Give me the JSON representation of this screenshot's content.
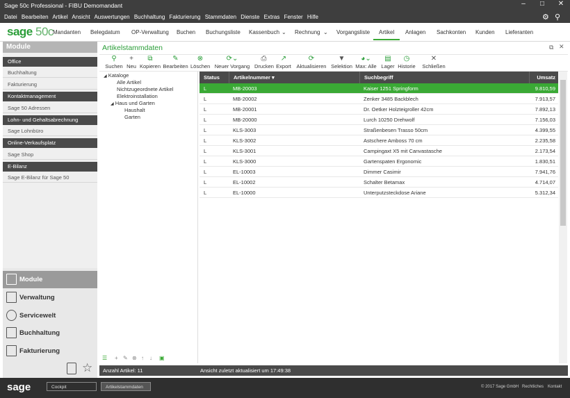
{
  "window": {
    "title": "Sage 50c Professional - FIBU Demomandant"
  },
  "menu": [
    "Datei",
    "Bearbeiten",
    "Artikel",
    "Ansicht",
    "Auswertungen",
    "Buchhaltung",
    "Fakturierung",
    "Stammdaten",
    "Dienste",
    "Extras",
    "Fenster",
    "Hilfe"
  ],
  "logo": {
    "brand": "sage",
    "product": "50c"
  },
  "nav": [
    {
      "label": "Mandanten"
    },
    {
      "label": "Belegdatum"
    },
    {
      "label": "OP-Verwaltung"
    },
    {
      "label": "Buchen"
    },
    {
      "label": "Buchungsliste"
    },
    {
      "label": "Kassenbuch"
    },
    {
      "label": "Rechnung"
    },
    {
      "label": "Vorgangsliste"
    },
    {
      "label": "Artikel"
    },
    {
      "label": "Anlagen"
    },
    {
      "label": "Sachkonten"
    },
    {
      "label": "Kunden"
    },
    {
      "label": "Lieferanten"
    }
  ],
  "sidebar": {
    "title": "Module",
    "rows": [
      {
        "label": "Office",
        "dark": true
      },
      {
        "label": "Buchhaltung",
        "dark": false
      },
      {
        "label": "Fakturierung",
        "dark": false
      },
      {
        "label": "Kontaktmanagement",
        "dark": true
      },
      {
        "label": "Sage 50 Adressen",
        "dark": false
      },
      {
        "label": "Lohn- und Gehaltsabrechnung",
        "dark": true
      },
      {
        "label": "Sage Lohnbüro",
        "dark": false
      },
      {
        "label": "Online-Verkaufsplatz",
        "dark": true
      },
      {
        "label": "Sage Shop",
        "dark": false
      },
      {
        "label": "E-Bilanz",
        "dark": true
      },
      {
        "label": "Sage E-Bilanz für Sage 50",
        "dark": false
      }
    ],
    "modules": [
      {
        "label": "Module",
        "selected": true
      },
      {
        "label": "Verwaltung",
        "selected": false
      },
      {
        "label": "Servicewelt",
        "selected": false
      },
      {
        "label": "Buchhaltung",
        "selected": false
      },
      {
        "label": "Fakturierung",
        "selected": false
      }
    ]
  },
  "main": {
    "title": "Artikelstammdaten",
    "toolbar": [
      {
        "label": "Suchen",
        "icon": "search-icon"
      },
      {
        "label": "Neu",
        "icon": "plus-icon"
      },
      {
        "label": "Kopieren",
        "icon": "copy-icon"
      },
      {
        "label": "Bearbeiten",
        "icon": "edit-icon"
      },
      {
        "label": "Löschen",
        "icon": "delete-icon"
      },
      {
        "label": "Neuer Vorgang",
        "icon": "new-process-icon"
      },
      {
        "label": "Drucken",
        "icon": "print-icon"
      },
      {
        "label": "Export",
        "icon": "export-icon"
      },
      {
        "label": "Aktualisieren",
        "icon": "refresh-icon"
      },
      {
        "label": "Selektion",
        "icon": "filter-icon"
      },
      {
        "label": "Max: Alle",
        "icon": "gauge-icon"
      },
      {
        "label": "Lager",
        "icon": "warehouse-icon"
      },
      {
        "label": "Historie",
        "icon": "history-icon"
      },
      {
        "label": "Schließen",
        "icon": "close-icon"
      }
    ],
    "tree": {
      "root": "Kataloge",
      "items": [
        "Alle Artikel",
        "Nichtzugeordnete Artikel",
        "Elektroinstallation",
        "Haus und Garten"
      ],
      "subitems": [
        "Haushalt",
        "Garten"
      ]
    },
    "grid": {
      "headers": [
        "Status",
        "Artikelnummer",
        "Suchbegriff",
        "Umsatz"
      ],
      "rows": [
        {
          "status": "L",
          "nr": "MB-20003",
          "such": "Kaiser 1251 Springform",
          "umsatz": "9.810,59"
        },
        {
          "status": "L",
          "nr": "MB-20002",
          "such": "Zenker 3485 Backblech",
          "umsatz": "7.913,57"
        },
        {
          "status": "L",
          "nr": "MB-20001",
          "such": "Dr. Oetker Holzteigroller 42cm",
          "umsatz": "7.892,13"
        },
        {
          "status": "L",
          "nr": "MB-20000",
          "such": "Lurch 10250 Drehwolf",
          "umsatz": "7.156,03"
        },
        {
          "status": "L",
          "nr": "KLS-3003",
          "such": "Straßenbesen Trasso 50cm",
          "umsatz": "4.399,55"
        },
        {
          "status": "L",
          "nr": "KLS-3002",
          "such": "Astschere Amboss 70 cm",
          "umsatz": "2.235,58"
        },
        {
          "status": "L",
          "nr": "KLS-3001",
          "such": "Campingaxt X5 mit Canvastasche",
          "umsatz": "2.173,54"
        },
        {
          "status": "L",
          "nr": "KLS-3000",
          "such": "Gartenspaten Ergonomic",
          "umsatz": "1.830,51"
        },
        {
          "status": "L",
          "nr": "EL-10003",
          "such": "Dimmer Casimir",
          "umsatz": "7.941,76"
        },
        {
          "status": "L",
          "nr": "EL-10002",
          "such": "Schalter Betamax",
          "umsatz": "4.714,07"
        },
        {
          "status": "L",
          "nr": "EL-10000",
          "such": "Unterputzsteckdose Ariane",
          "umsatz": "5.312,34"
        }
      ]
    },
    "status": {
      "count": "Anzahl Artikel:  11",
      "updated": "Ansicht zuletzt aktualisiert um 17:49:38"
    }
  },
  "footer": {
    "logo": "sage",
    "tabs": [
      "Cockpit",
      "Artikelstammdaten"
    ],
    "copyright": "© 2017 Sage GmbH",
    "links": [
      "Rechtliches",
      "Kontakt"
    ]
  },
  "colors": {
    "accent": "#3aa935",
    "dark": "#3e3e3e"
  }
}
